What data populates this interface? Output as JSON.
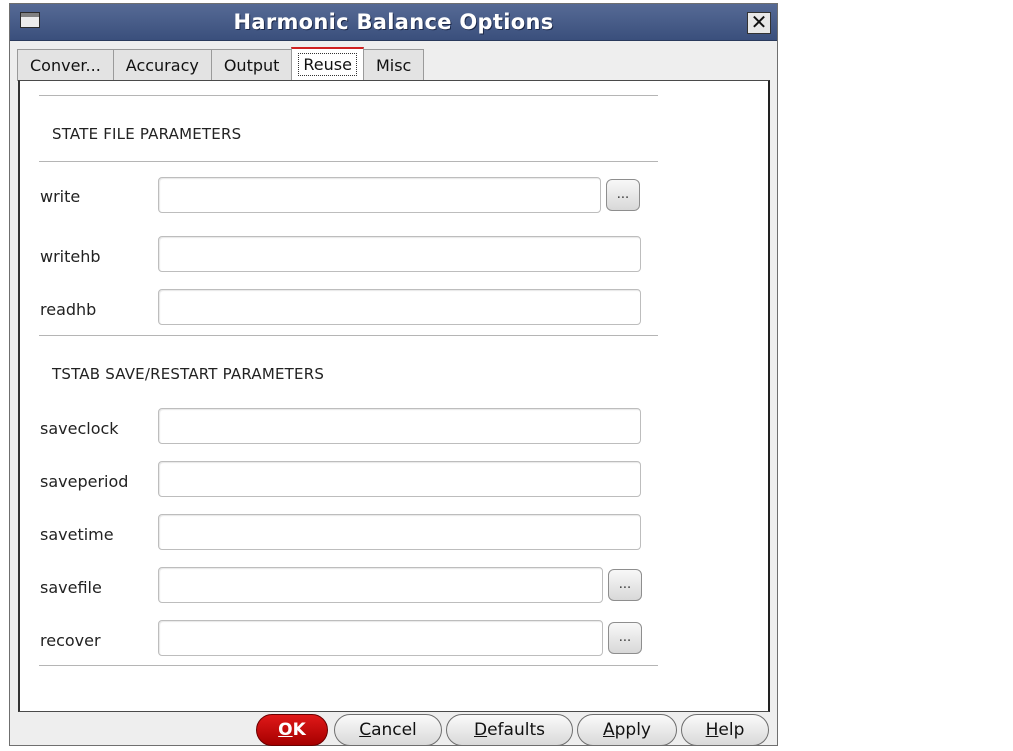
{
  "window": {
    "title": "Harmonic Balance Options",
    "close_glyph": "✕"
  },
  "tabs": [
    {
      "label": "Conver..."
    },
    {
      "label": "Accuracy"
    },
    {
      "label": "Output"
    },
    {
      "label": "Reuse"
    },
    {
      "label": "Misc"
    }
  ],
  "active_tab": "Reuse",
  "sections": {
    "state": {
      "header": "STATE FILE PARAMETERS"
    },
    "tstab": {
      "header": "TSTAB SAVE/RESTART PARAMETERS"
    }
  },
  "fields": {
    "write": {
      "label": "write",
      "value": ""
    },
    "writehb": {
      "label": "writehb",
      "value": ""
    },
    "readhb": {
      "label": "readhb",
      "value": ""
    },
    "saveclock": {
      "label": "saveclock",
      "value": ""
    },
    "saveperiod": {
      "label": "saveperiod",
      "value": ""
    },
    "savetime": {
      "label": "savetime",
      "value": ""
    },
    "savefile": {
      "label": "savefile",
      "value": ""
    },
    "recover": {
      "label": "recover",
      "value": ""
    }
  },
  "browse_label": "...",
  "buttons": {
    "ok": {
      "label": "OK",
      "mnemonic": "O",
      "rest": "K"
    },
    "cancel": {
      "label": "Cancel",
      "mnemonic": "C",
      "rest": "ancel"
    },
    "defaults": {
      "label": "Defaults",
      "mnemonic": "D",
      "rest": "efaults"
    },
    "apply": {
      "label": "Apply",
      "mnemonic": "A",
      "rest": "pply"
    },
    "help": {
      "label": "Help",
      "mnemonic": "H",
      "rest": "elp"
    }
  },
  "colors": {
    "titlebar": "#3a4f7c",
    "ok_button": "#c00000",
    "active_tab_marker": "#d02020"
  },
  "icons": {
    "window_icon": "window-menu-icon",
    "close": "close-icon",
    "browse": "ellipsis-browse-icon"
  }
}
